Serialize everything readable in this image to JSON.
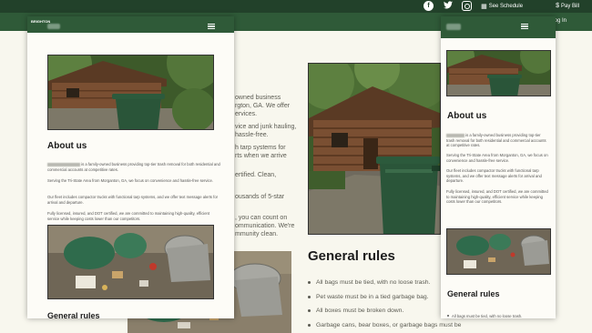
{
  "top_bar": {
    "social": [
      {
        "icon": "facebook-icon",
        "glyph": "f"
      },
      {
        "icon": "twitter-icon",
        "glyph": "🐦"
      },
      {
        "icon": "instagram-icon",
        "glyph": ""
      }
    ],
    "see_schedule": {
      "icon": "calendar-icon",
      "label": "See Schedule"
    },
    "pay_bill": {
      "icon": "dollar-icon",
      "label": "Pay Bill"
    }
  },
  "nav": {
    "login_label": "Log In"
  },
  "background_page": {
    "intro_fragments": [
      "owned business",
      "rgton, GA. We offer",
      "ervices.",
      "vice and junk hauling,",
      "hassle-free.",
      "h tarp systems for",
      "rts when we arrive",
      "ertified. Clean,",
      "ousands of 5-star",
      ", you can count on",
      "ommunication. We're",
      "mmunity clean."
    ],
    "general_rules_title": "General rules",
    "rules": [
      "All bags must be tied, with no loose trash.",
      "Pet waste must be in a tied garbage bag.",
      "All boxes must be broken down.",
      "Garbage cans, bear boxes, or garbage bags must be"
    ]
  },
  "mobile": {
    "logo_text": "BRIGHTON",
    "about_title": "About us",
    "paragraphs": [
      "is a family-owned business providing top-tier trash removal for both residential and commercial accounts at competitive rates.",
      "Serving the Tri-State Area from Morganton, GA, we focus on convenience and hassle-free service.",
      "Our fleet includes compactor trucks with functional tarp systems, and we offer text message alerts for arrival and departure.",
      "Fully licensed, insured, and DOT certified, we are committed to maintaining high-quality, efficient service while keeping costs lower than our competitors."
    ],
    "general_rules_title": "General rules",
    "first_rule": "All bags must be tied, with no loose trash."
  },
  "colors": {
    "dark_green": "#22412a",
    "green": "#2f5a38",
    "page_bg": "#f8f7ee"
  }
}
